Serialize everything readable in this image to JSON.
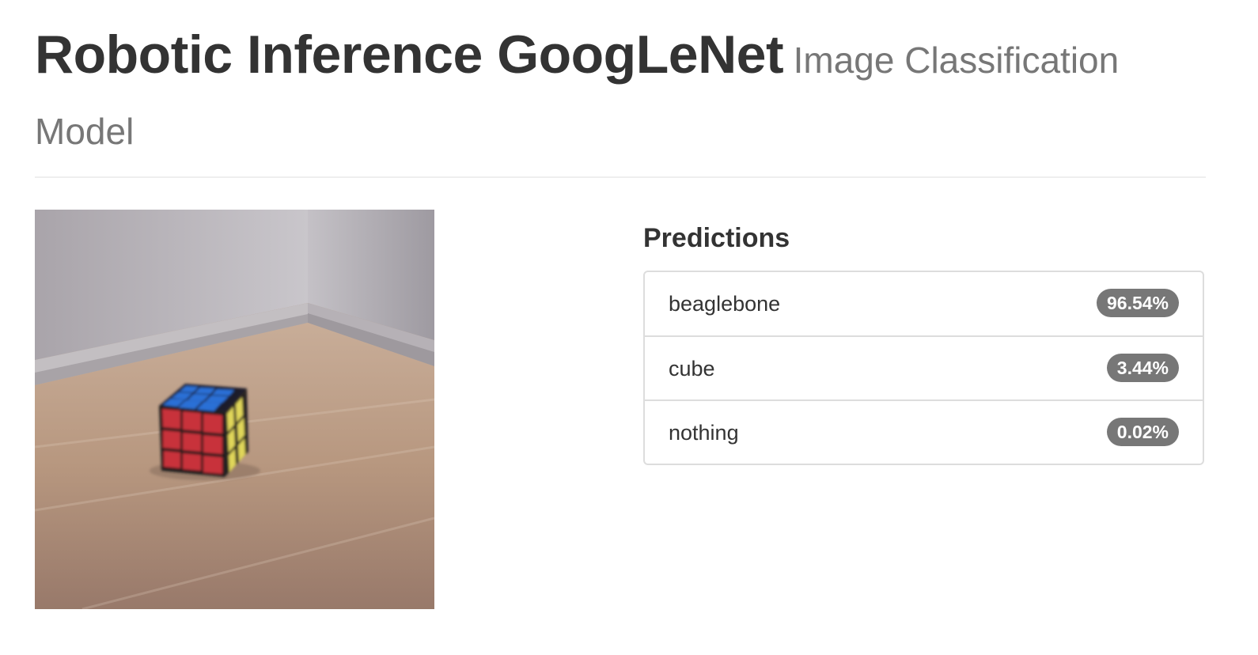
{
  "header": {
    "title": "Robotic Inference GoogLeNet",
    "subtitle": "Image Classification Model"
  },
  "image": {
    "subject": "rubiks-cube-on-wooden-floor"
  },
  "predictions": {
    "heading": "Predictions",
    "items": [
      {
        "label": "beaglebone",
        "percent": "96.54%"
      },
      {
        "label": "cube",
        "percent": "3.44%"
      },
      {
        "label": "nothing",
        "percent": "0.02%"
      }
    ]
  },
  "colors": {
    "badge": "#777777",
    "title": "#333333",
    "subtitle": "#777777",
    "border": "#dddddd"
  }
}
